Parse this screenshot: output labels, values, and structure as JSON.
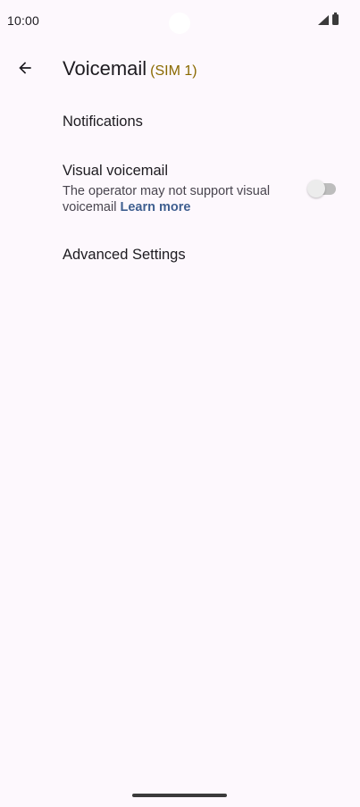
{
  "status_bar": {
    "time": "10:00",
    "icons": [
      "signal-icon",
      "battery-icon"
    ]
  },
  "app_bar": {
    "back_icon": "arrow-back-icon",
    "title": "Voicemail",
    "title_suffix": "(SIM 1)"
  },
  "settings": {
    "notifications": {
      "title": "Notifications"
    },
    "visual_voicemail": {
      "title": "Visual voicemail",
      "summary": "The operator may not support visual voicemail",
      "link": "Learn more",
      "toggle_on": false
    },
    "advanced": {
      "title": "Advanced Settings"
    }
  },
  "colors": {
    "background": "#fdf8fd",
    "title_suffix": "#8a6a00",
    "link": "#3f5f90"
  }
}
